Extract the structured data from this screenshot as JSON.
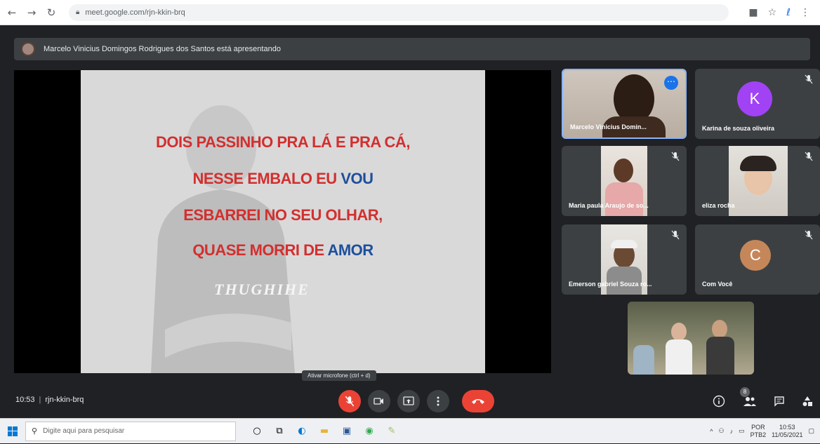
{
  "browser": {
    "url": "meet.google.com/rjn-kkin-brq",
    "nav": {
      "back": "←",
      "forward": "→",
      "reload": "↻"
    }
  },
  "presenter": {
    "banner_text": "Marcelo Vinicius Domingos Rodrigues dos Santos está apresentando"
  },
  "slide": {
    "lines": [
      {
        "parts": [
          {
            "text": "DOIS PASSINHO PRA LÁ E PRA CÁ,",
            "blue": false
          }
        ]
      },
      {
        "parts": [
          {
            "text": "NESSE EMBALO EU ",
            "blue": false
          },
          {
            "text": "VOU",
            "blue": true
          }
        ]
      },
      {
        "parts": [
          {
            "text": "ESBARREI NO SEU OLHAR,",
            "blue": false
          }
        ]
      },
      {
        "parts": [
          {
            "text": "QUASE MORRI DE ",
            "blue": false
          },
          {
            "text": "AMOR",
            "blue": true
          }
        ]
      }
    ],
    "shirt_text": "THUGHIHE"
  },
  "participants": [
    {
      "name": "Marcelo Vinicius Domin...",
      "type": "video"
    },
    {
      "name": "Karina de souza oliveira",
      "type": "avatar",
      "letter": "K",
      "color": "#a142f4"
    },
    {
      "name": "Maria paula Araujo de so...",
      "type": "video"
    },
    {
      "name": "eliza rocha",
      "type": "video"
    },
    {
      "name": "Emerson gabriel Souza ro...",
      "type": "video"
    },
    {
      "name": "Com Você",
      "type": "avatar",
      "letter": "C",
      "color": "#c5875a"
    }
  ],
  "controls": {
    "time": "10:53",
    "separator": "|",
    "meeting_code": "rjn-kkin-brq",
    "tooltip": "Ativar microfone (ctrl + d)",
    "people_count": "8"
  },
  "taskbar": {
    "search_placeholder": "Digite aqui para pesquisar",
    "lang_top": "POR",
    "lang_bottom": "PTB2",
    "clock_time": "10:53",
    "clock_date": "11/05/2021"
  },
  "colors": {
    "lyric_red": "#d32f2f",
    "lyric_blue": "#1e4f9c",
    "hangup_red": "#ea4335",
    "active_tile_border": "#8ab4f8"
  }
}
